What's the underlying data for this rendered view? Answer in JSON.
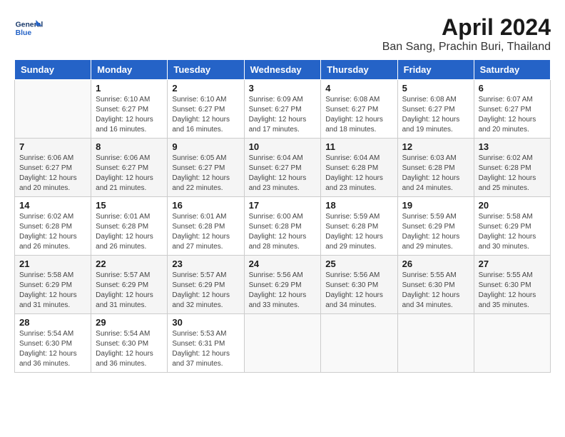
{
  "header": {
    "logo_general": "General",
    "logo_blue": "Blue",
    "title": "April 2024",
    "subtitle": "Ban Sang, Prachin Buri, Thailand"
  },
  "columns": [
    "Sunday",
    "Monday",
    "Tuesday",
    "Wednesday",
    "Thursday",
    "Friday",
    "Saturday"
  ],
  "weeks": [
    [
      {
        "day": "",
        "info": ""
      },
      {
        "day": "1",
        "info": "Sunrise: 6:10 AM\nSunset: 6:27 PM\nDaylight: 12 hours\nand 16 minutes."
      },
      {
        "day": "2",
        "info": "Sunrise: 6:10 AM\nSunset: 6:27 PM\nDaylight: 12 hours\nand 16 minutes."
      },
      {
        "day": "3",
        "info": "Sunrise: 6:09 AM\nSunset: 6:27 PM\nDaylight: 12 hours\nand 17 minutes."
      },
      {
        "day": "4",
        "info": "Sunrise: 6:08 AM\nSunset: 6:27 PM\nDaylight: 12 hours\nand 18 minutes."
      },
      {
        "day": "5",
        "info": "Sunrise: 6:08 AM\nSunset: 6:27 PM\nDaylight: 12 hours\nand 19 minutes."
      },
      {
        "day": "6",
        "info": "Sunrise: 6:07 AM\nSunset: 6:27 PM\nDaylight: 12 hours\nand 20 minutes."
      }
    ],
    [
      {
        "day": "7",
        "info": "Sunrise: 6:06 AM\nSunset: 6:27 PM\nDaylight: 12 hours\nand 20 minutes."
      },
      {
        "day": "8",
        "info": "Sunrise: 6:06 AM\nSunset: 6:27 PM\nDaylight: 12 hours\nand 21 minutes."
      },
      {
        "day": "9",
        "info": "Sunrise: 6:05 AM\nSunset: 6:27 PM\nDaylight: 12 hours\nand 22 minutes."
      },
      {
        "day": "10",
        "info": "Sunrise: 6:04 AM\nSunset: 6:27 PM\nDaylight: 12 hours\nand 23 minutes."
      },
      {
        "day": "11",
        "info": "Sunrise: 6:04 AM\nSunset: 6:28 PM\nDaylight: 12 hours\nand 23 minutes."
      },
      {
        "day": "12",
        "info": "Sunrise: 6:03 AM\nSunset: 6:28 PM\nDaylight: 12 hours\nand 24 minutes."
      },
      {
        "day": "13",
        "info": "Sunrise: 6:02 AM\nSunset: 6:28 PM\nDaylight: 12 hours\nand 25 minutes."
      }
    ],
    [
      {
        "day": "14",
        "info": "Sunrise: 6:02 AM\nSunset: 6:28 PM\nDaylight: 12 hours\nand 26 minutes."
      },
      {
        "day": "15",
        "info": "Sunrise: 6:01 AM\nSunset: 6:28 PM\nDaylight: 12 hours\nand 26 minutes."
      },
      {
        "day": "16",
        "info": "Sunrise: 6:01 AM\nSunset: 6:28 PM\nDaylight: 12 hours\nand 27 minutes."
      },
      {
        "day": "17",
        "info": "Sunrise: 6:00 AM\nSunset: 6:28 PM\nDaylight: 12 hours\nand 28 minutes."
      },
      {
        "day": "18",
        "info": "Sunrise: 5:59 AM\nSunset: 6:28 PM\nDaylight: 12 hours\nand 29 minutes."
      },
      {
        "day": "19",
        "info": "Sunrise: 5:59 AM\nSunset: 6:29 PM\nDaylight: 12 hours\nand 29 minutes."
      },
      {
        "day": "20",
        "info": "Sunrise: 5:58 AM\nSunset: 6:29 PM\nDaylight: 12 hours\nand 30 minutes."
      }
    ],
    [
      {
        "day": "21",
        "info": "Sunrise: 5:58 AM\nSunset: 6:29 PM\nDaylight: 12 hours\nand 31 minutes."
      },
      {
        "day": "22",
        "info": "Sunrise: 5:57 AM\nSunset: 6:29 PM\nDaylight: 12 hours\nand 31 minutes."
      },
      {
        "day": "23",
        "info": "Sunrise: 5:57 AM\nSunset: 6:29 PM\nDaylight: 12 hours\nand 32 minutes."
      },
      {
        "day": "24",
        "info": "Sunrise: 5:56 AM\nSunset: 6:29 PM\nDaylight: 12 hours\nand 33 minutes."
      },
      {
        "day": "25",
        "info": "Sunrise: 5:56 AM\nSunset: 6:30 PM\nDaylight: 12 hours\nand 34 minutes."
      },
      {
        "day": "26",
        "info": "Sunrise: 5:55 AM\nSunset: 6:30 PM\nDaylight: 12 hours\nand 34 minutes."
      },
      {
        "day": "27",
        "info": "Sunrise: 5:55 AM\nSunset: 6:30 PM\nDaylight: 12 hours\nand 35 minutes."
      }
    ],
    [
      {
        "day": "28",
        "info": "Sunrise: 5:54 AM\nSunset: 6:30 PM\nDaylight: 12 hours\nand 36 minutes."
      },
      {
        "day": "29",
        "info": "Sunrise: 5:54 AM\nSunset: 6:30 PM\nDaylight: 12 hours\nand 36 minutes."
      },
      {
        "day": "30",
        "info": "Sunrise: 5:53 AM\nSunset: 6:31 PM\nDaylight: 12 hours\nand 37 minutes."
      },
      {
        "day": "",
        "info": ""
      },
      {
        "day": "",
        "info": ""
      },
      {
        "day": "",
        "info": ""
      },
      {
        "day": "",
        "info": ""
      }
    ]
  ]
}
